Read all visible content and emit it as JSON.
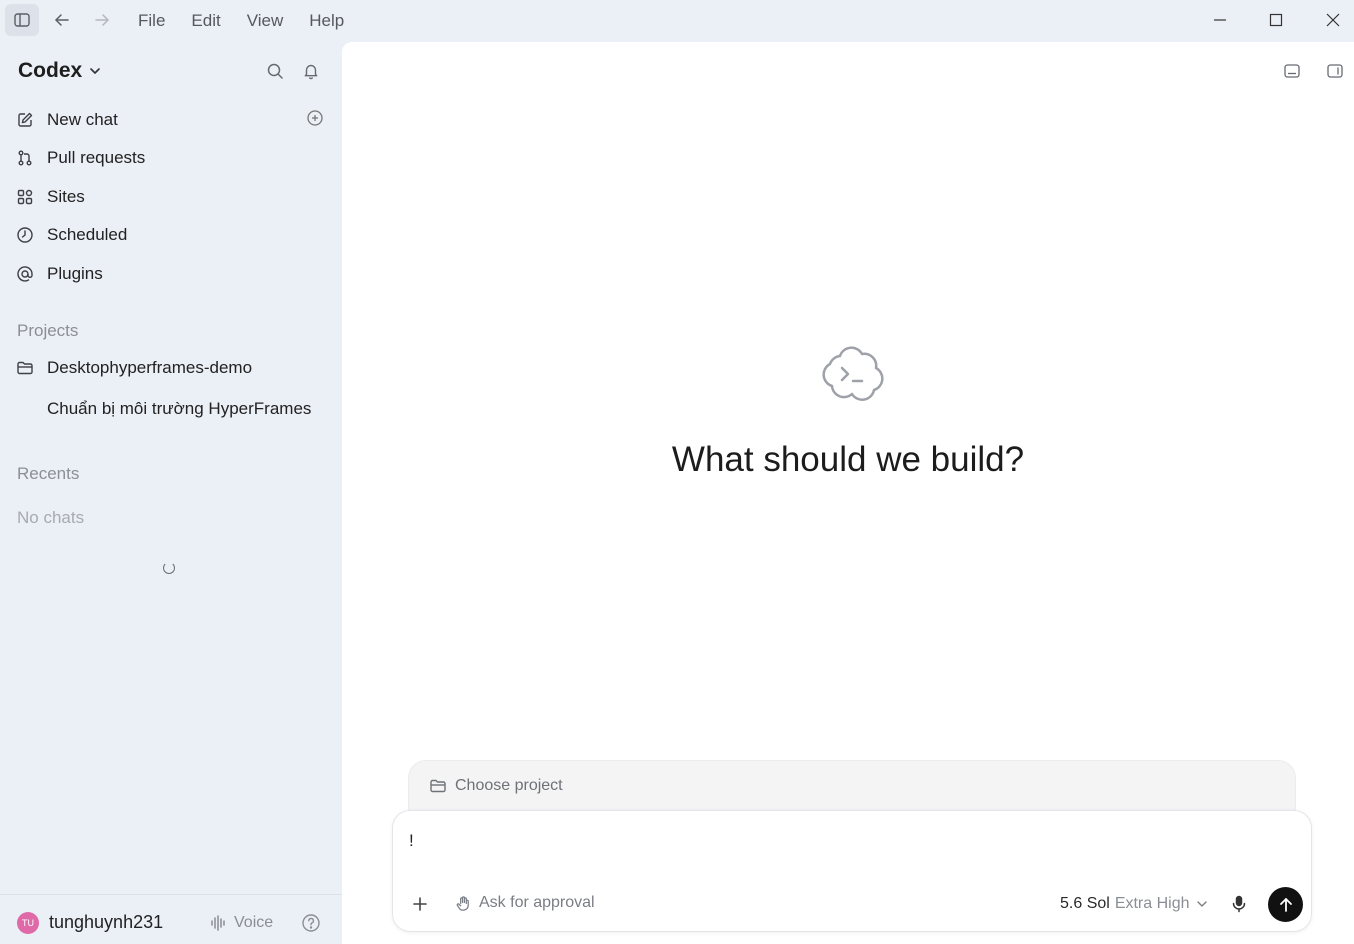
{
  "menu": [
    "File",
    "Edit",
    "View",
    "Help"
  ],
  "sidebar": {
    "brand": "Codex",
    "nav": [
      {
        "label": "New chat",
        "icon": "edit-icon"
      },
      {
        "label": "Pull requests",
        "icon": "pull-request-icon"
      },
      {
        "label": "Sites",
        "icon": "grid-icon"
      },
      {
        "label": "Scheduled",
        "icon": "clock-icon"
      },
      {
        "label": "Plugins",
        "icon": "at-icon"
      }
    ],
    "projects_heading": "Projects",
    "projects": [
      {
        "label": "Desktophyperframes-demo",
        "icon": "folder-icon"
      },
      {
        "label": "Chuẩn bị môi trường HyperFrames"
      }
    ],
    "recents_heading": "Recents",
    "recents_empty": "No chats",
    "footer": {
      "avatar_initials": "TU",
      "username": "tunghuynh231",
      "voice_label": "Voice"
    }
  },
  "main": {
    "hero_title": "What should we build?",
    "project_picker_label": "Choose project",
    "composer_text": "!",
    "approval_label": "Ask for approval",
    "model_name": "5.6 Sol",
    "model_level": "Extra High"
  },
  "colors": {
    "sidebar_bg": "#ebeff6",
    "main_bg": "#ffffff",
    "avatar": "#e06aa8",
    "send_button": "#111111"
  }
}
